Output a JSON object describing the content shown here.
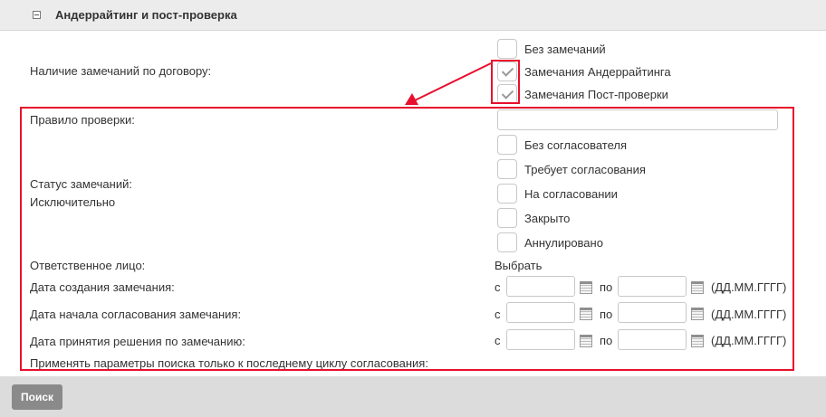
{
  "section": {
    "title": "Андеррайтинг и пост-проверка"
  },
  "remarks": {
    "label": "Наличие замечаний по договору:",
    "options": [
      {
        "label": "Без замечаний",
        "checked": false
      },
      {
        "label": "Замечания Андеррайтинга",
        "checked": true
      },
      {
        "label": "Замечания Пост-проверки",
        "checked": true
      }
    ]
  },
  "rule": {
    "label": "Правило проверки:",
    "value": ""
  },
  "status": {
    "label": "Статус замечаний:",
    "sublabel": "Исключительно",
    "options": [
      {
        "label": "Без согласователя",
        "checked": false
      },
      {
        "label": "Требует согласования",
        "checked": false
      },
      {
        "label": "На согласовании",
        "checked": false
      },
      {
        "label": "Закрыто",
        "checked": false
      },
      {
        "label": "Аннулировано",
        "checked": false
      }
    ]
  },
  "responsible": {
    "label": "Ответственное лицо:",
    "action": "Выбрать"
  },
  "date_rows": [
    {
      "label": "Дата создания замечания:",
      "from": "с",
      "to": "по",
      "format": "(ДД.ММ.ГГГГ)"
    },
    {
      "label": "Дата начала согласования замечания:",
      "from": "с",
      "to": "по",
      "format": "(ДД.ММ.ГГГГ)"
    },
    {
      "label": "Дата принятия решения по замечанию:",
      "from": "с",
      "to": "по",
      "format": "(ДД.ММ.ГГГГ)"
    }
  ],
  "last_cycle_note": "Применять параметры поиска только к последнему циклу согласования:",
  "footer": {
    "search_label": "Поиск"
  },
  "colors": {
    "highlight": "#e8102c",
    "header_bg": "#ececec",
    "footer_bg": "#dcdcdc",
    "button_bg": "#8a8a8a"
  },
  "icons": [
    "collapse-icon",
    "calendar-icon",
    "checkmark-icon"
  ]
}
